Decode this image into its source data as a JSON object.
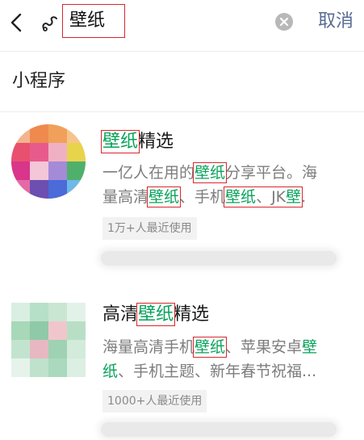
{
  "search": {
    "query": "壁纸",
    "cancel_label": "取消"
  },
  "section": {
    "title": "小程序"
  },
  "results": [
    {
      "title_parts": [
        "壁纸",
        "精选"
      ],
      "desc_line1": [
        "一亿人在用的",
        "壁纸",
        "分享平台。海"
      ],
      "desc_line2": [
        "量高清",
        "壁纸",
        "、手机",
        "壁纸",
        "、JK",
        "壁",
        "."
      ],
      "usage": "1万+人最近使用"
    },
    {
      "title_parts": [
        "高清",
        "壁纸",
        "精选"
      ],
      "desc_line1": [
        "海量高清手机",
        "壁纸",
        "、苹果安卓",
        "壁"
      ],
      "desc_line2": [
        "纸",
        "、手机主题、新年春节祝福..."
      ],
      "usage": "1000+人最近使用"
    }
  ],
  "colors": {
    "highlight": "#07a35b",
    "link": "#576b95",
    "annotation_box": "#d9272e"
  },
  "icons": {
    "back": "chevron-left-icon",
    "brand": "wechat-search-icon",
    "clear": "clear-icon"
  }
}
